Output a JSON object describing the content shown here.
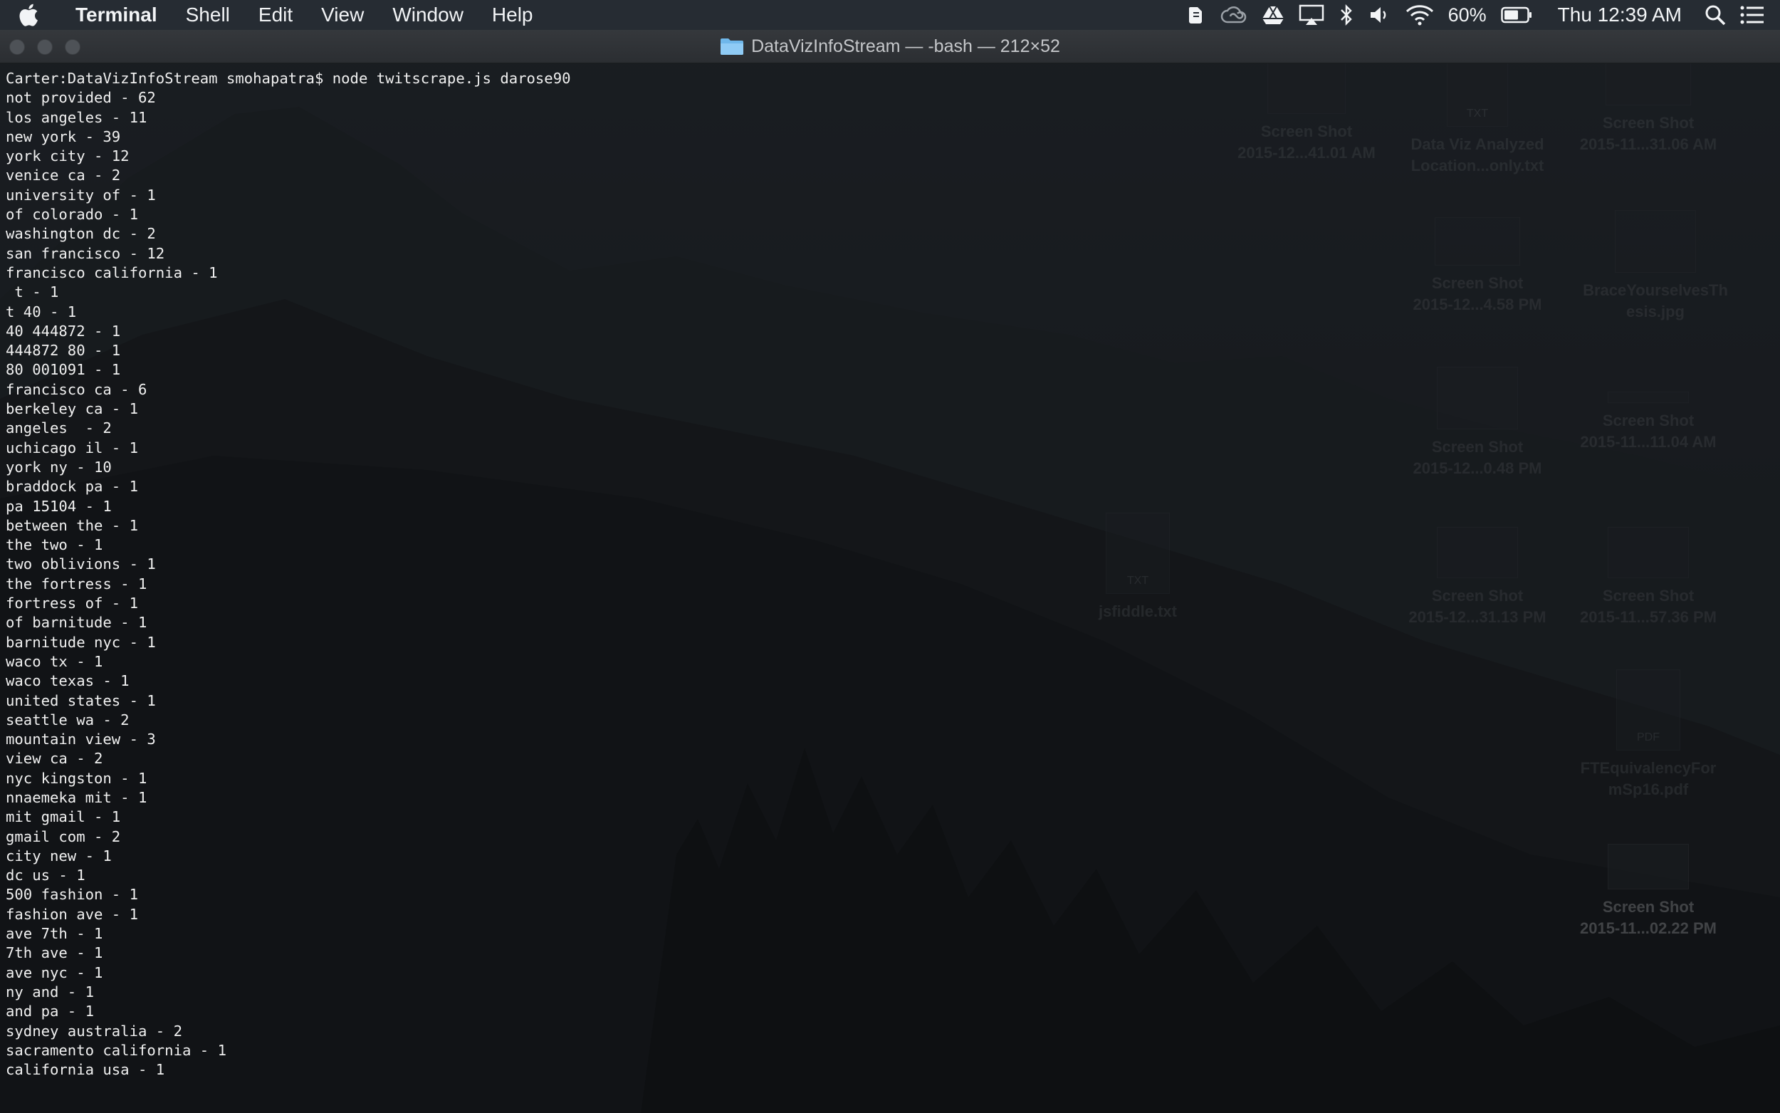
{
  "menubar": {
    "app_name": "Terminal",
    "menus": [
      "Shell",
      "Edit",
      "View",
      "Window",
      "Help"
    ],
    "battery": "60%",
    "clock": "Thu 12:39 AM"
  },
  "window": {
    "title": "DataVizInfoStream — -bash — 212×52"
  },
  "terminal": {
    "lines": [
      "Carter:DataVizInfoStream smohapatra$ node twitscrape.js darose90",
      "not provided - 62",
      "los angeles - 11",
      "new york - 39",
      "york city - 12",
      "venice ca - 2",
      "university of - 1",
      "of colorado - 1",
      "washington dc - 2",
      "san francisco - 12",
      "francisco california - 1",
      " t - 1",
      "t 40 - 1",
      "40 444872 - 1",
      "444872 80 - 1",
      "80 001091 - 1",
      "francisco ca - 6",
      "berkeley ca - 1",
      "angeles  - 2",
      "uchicago il - 1",
      "york ny - 10",
      "braddock pa - 1",
      "pa 15104 - 1",
      "between the - 1",
      "the two - 1",
      "two oblivions - 1",
      "the fortress - 1",
      "fortress of - 1",
      "of barnitude - 1",
      "barnitude nyc - 1",
      "waco tx - 1",
      "waco texas - 1",
      "united states - 1",
      "seattle wa - 2",
      "mountain view - 3",
      "view ca - 2",
      "nyc kingston - 1",
      "nnaemeka mit - 1",
      "mit gmail - 1",
      "gmail com - 2",
      "city new - 1",
      "dc us - 1",
      "500 fashion - 1",
      "fashion ave - 1",
      "ave 7th - 1",
      "7th ave - 1",
      "ave nyc - 1",
      "ny and - 1",
      "and pa - 1",
      "sydney australia - 2",
      "sacramento california - 1",
      "california usa - 1"
    ]
  },
  "desktop": {
    "icons": [
      {
        "line1": "Screen Shot",
        "line2": "2015-12...41.01 AM",
        "icon": "screenshot-icon"
      },
      {
        "line1": "Data Viz Analyzed",
        "line2": "Location...only.txt",
        "icon": "txt-file-icon",
        "badge": "TXT"
      },
      {
        "line1": "Screen Shot",
        "line2": "2015-11...31.06 AM",
        "icon": "screenshot-icon"
      },
      {
        "line1": "Screen Shot",
        "line2": "2015-12...4.58 PM",
        "icon": "screenshot-icon"
      },
      {
        "line1": "BraceYourselvesTh",
        "line2": "esis.jpg",
        "icon": "image-file-icon"
      },
      {
        "line1": "Screen Shot",
        "line2": "2015-12...0.48 PM",
        "icon": "screenshot-icon"
      },
      {
        "line1": "Screen Shot",
        "line2": "2015-11...11.04 AM",
        "icon": "screenshot-icon"
      },
      {
        "line1": "jsfiddle.txt",
        "line2": "",
        "icon": "txt-file-icon",
        "badge": "TXT"
      },
      {
        "line1": "Screen Shot",
        "line2": "2015-12...31.13 PM",
        "icon": "screenshot-icon"
      },
      {
        "line1": "Screen Shot",
        "line2": "2015-11...57.36 PM",
        "icon": "screenshot-icon"
      },
      {
        "line1": "FTEquivalencyFor",
        "line2": "mSp16.pdf",
        "icon": "pdf-file-icon",
        "badge": "PDF"
      },
      {
        "line1": "Screen Shot",
        "line2": "2015-11...02.22 PM",
        "icon": "screenshot-icon"
      }
    ]
  }
}
